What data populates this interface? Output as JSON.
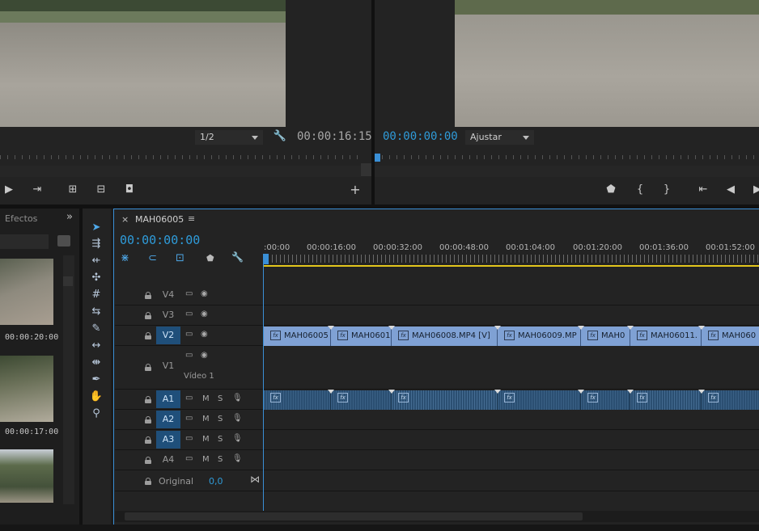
{
  "source_monitor": {
    "resolution": "1/2",
    "timecode": "00:00:16:15"
  },
  "program_monitor": {
    "timecode": "00:00:00:00",
    "fit": "Ajustar"
  },
  "left_panel": {
    "tab": "Efectos",
    "thumbnails": [
      {
        "duration": "00:00:20:00"
      },
      {
        "duration": "00:00:17:00"
      },
      {
        "duration": ""
      }
    ]
  },
  "timeline": {
    "sequence_name": "MAH06005",
    "close": "×",
    "menu": "≡",
    "timecode": "00:00:00:00",
    "ruler_labels": [
      ":00:00",
      "00:00:16:00",
      "00:00:32:00",
      "00:00:48:00",
      "00:01:04:00",
      "00:01:20:00",
      "00:01:36:00",
      "00:01:52:00"
    ],
    "video_tracks": [
      {
        "name": "V4",
        "target": false
      },
      {
        "name": "V3",
        "target": false
      },
      {
        "name": "V2",
        "target": true
      },
      {
        "name": "V1",
        "target": false,
        "label": "Vídeo 1"
      }
    ],
    "audio_tracks": [
      {
        "name": "A1",
        "target": true,
        "m": "M",
        "s": "S"
      },
      {
        "name": "A2",
        "target": true,
        "m": "M",
        "s": "S"
      },
      {
        "name": "A3",
        "target": true,
        "m": "M",
        "s": "S"
      },
      {
        "name": "A4",
        "target": false,
        "m": "M",
        "s": "S"
      }
    ],
    "master": {
      "label": "Original",
      "value": "0,0"
    },
    "video_clips": [
      "MAH06005",
      "MAH0601",
      "MAH06008.MP4 [V]",
      "MAH06009.MP",
      "MAH0",
      "MAH06011.",
      "MAH060"
    ]
  },
  "colors": {
    "accent_blue": "#2f9bd9",
    "clip_video": "#7fa1d4",
    "clip_audio": "#2b4f72",
    "playhead": "#3a8fd6",
    "work_area": "#e3c61c"
  }
}
